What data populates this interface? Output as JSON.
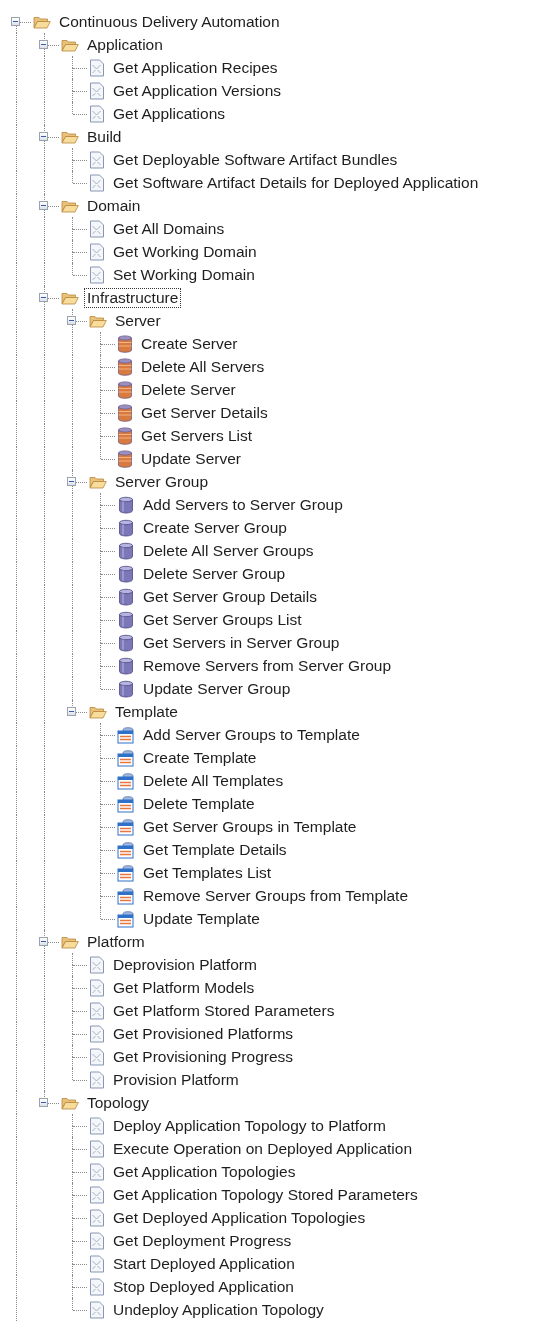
{
  "tree": {
    "label": "Continuous Delivery Automation",
    "kind": "folder",
    "expanded": true,
    "focused": false,
    "children": [
      {
        "label": "Application",
        "kind": "folder",
        "expanded": true,
        "focused": false,
        "children": [
          {
            "label": "Get Application Recipes",
            "kind": "document",
            "focused": false
          },
          {
            "label": "Get Application Versions",
            "kind": "document",
            "focused": false
          },
          {
            "label": "Get Applications",
            "kind": "document",
            "focused": false
          }
        ]
      },
      {
        "label": "Build",
        "kind": "folder",
        "expanded": true,
        "focused": false,
        "children": [
          {
            "label": "Get Deployable Software Artifact Bundles",
            "kind": "document",
            "focused": false
          },
          {
            "label": "Get Software Artifact Details for Deployed Application",
            "kind": "document",
            "focused": false
          }
        ]
      },
      {
        "label": "Domain",
        "kind": "folder",
        "expanded": true,
        "focused": false,
        "children": [
          {
            "label": "Get All Domains",
            "kind": "document",
            "focused": false
          },
          {
            "label": "Get Working Domain",
            "kind": "document",
            "focused": false
          },
          {
            "label": "Set Working Domain",
            "kind": "document",
            "focused": false
          }
        ]
      },
      {
        "label": "Infrastructure",
        "kind": "folder",
        "expanded": true,
        "focused": true,
        "children": [
          {
            "label": "Server",
            "kind": "folder",
            "expanded": true,
            "focused": false,
            "children": [
              {
                "label": "Create Server",
                "kind": "server",
                "focused": false
              },
              {
                "label": "Delete All Servers",
                "kind": "server",
                "focused": false
              },
              {
                "label": "Delete Server",
                "kind": "server",
                "focused": false
              },
              {
                "label": "Get Server Details",
                "kind": "server",
                "focused": false
              },
              {
                "label": "Get Servers List",
                "kind": "server",
                "focused": false
              },
              {
                "label": "Update Server",
                "kind": "server",
                "focused": false
              }
            ]
          },
          {
            "label": "Server Group",
            "kind": "folder",
            "expanded": true,
            "focused": false,
            "children": [
              {
                "label": "Add Servers to Server Group",
                "kind": "server-group",
                "focused": false
              },
              {
                "label": "Create Server Group",
                "kind": "server-group",
                "focused": false
              },
              {
                "label": "Delete All Server Groups",
                "kind": "server-group",
                "focused": false
              },
              {
                "label": "Delete Server Group",
                "kind": "server-group",
                "focused": false
              },
              {
                "label": "Get Server Group Details",
                "kind": "server-group",
                "focused": false
              },
              {
                "label": "Get Server Groups List",
                "kind": "server-group",
                "focused": false
              },
              {
                "label": "Get Servers in Server Group",
                "kind": "server-group",
                "focused": false
              },
              {
                "label": "Remove Servers from Server Group",
                "kind": "server-group",
                "focused": false
              },
              {
                "label": "Update Server Group",
                "kind": "server-group",
                "focused": false
              }
            ]
          },
          {
            "label": "Template",
            "kind": "folder",
            "expanded": true,
            "focused": false,
            "children": [
              {
                "label": "Add Server Groups to Template",
                "kind": "template",
                "focused": false
              },
              {
                "label": "Create Template",
                "kind": "template",
                "focused": false
              },
              {
                "label": "Delete All Templates",
                "kind": "template",
                "focused": false
              },
              {
                "label": "Delete Template",
                "kind": "template",
                "focused": false
              },
              {
                "label": "Get Server Groups in Template",
                "kind": "template",
                "focused": false
              },
              {
                "label": "Get Template Details",
                "kind": "template",
                "focused": false
              },
              {
                "label": "Get Templates List",
                "kind": "template",
                "focused": false
              },
              {
                "label": "Remove Server Groups from Template",
                "kind": "template",
                "focused": false
              },
              {
                "label": "Update Template",
                "kind": "template",
                "focused": false
              }
            ]
          }
        ]
      },
      {
        "label": "Platform",
        "kind": "folder",
        "expanded": true,
        "focused": false,
        "children": [
          {
            "label": "Deprovision Platform",
            "kind": "document",
            "focused": false
          },
          {
            "label": "Get Platform Models",
            "kind": "document",
            "focused": false
          },
          {
            "label": "Get Platform Stored Parameters",
            "kind": "document",
            "focused": false
          },
          {
            "label": "Get Provisioned Platforms",
            "kind": "document",
            "focused": false
          },
          {
            "label": "Get Provisioning Progress",
            "kind": "document",
            "focused": false
          },
          {
            "label": "Provision Platform",
            "kind": "document",
            "focused": false
          }
        ]
      },
      {
        "label": "Topology",
        "kind": "folder",
        "expanded": true,
        "focused": false,
        "children": [
          {
            "label": "Deploy Application Topology to Platform",
            "kind": "document",
            "focused": false
          },
          {
            "label": "Execute Operation on Deployed Application",
            "kind": "document",
            "focused": false
          },
          {
            "label": "Get Application Topologies",
            "kind": "document",
            "focused": false
          },
          {
            "label": "Get Application Topology Stored Parameters",
            "kind": "document",
            "focused": false
          },
          {
            "label": "Get Deployed Application Topologies",
            "kind": "document",
            "focused": false
          },
          {
            "label": "Get Deployment Progress",
            "kind": "document",
            "focused": false
          },
          {
            "label": "Start Deployed Application",
            "kind": "document",
            "focused": false
          },
          {
            "label": "Stop Deployed Application",
            "kind": "document",
            "focused": false
          },
          {
            "label": "Undeploy Application Topology",
            "kind": "document",
            "focused": false
          }
        ]
      }
    ]
  }
}
